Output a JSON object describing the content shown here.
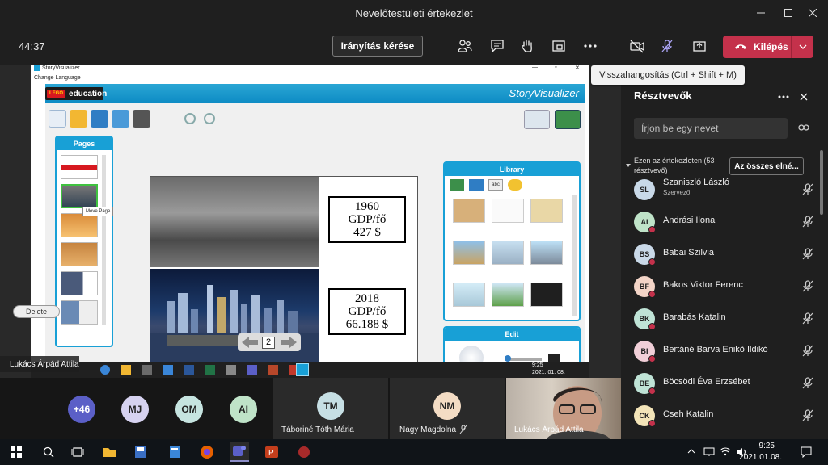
{
  "window": {
    "title": "Nevelőtestületi értekezlet"
  },
  "toolbar": {
    "timer": "44:37",
    "request_control_label": "Irányítás kérése",
    "leave_label": "Kilépés"
  },
  "tooltip": {
    "text": "Visszahangosítás (Ctrl + Shift + M)"
  },
  "shared_screen": {
    "app_title": "StoryVisualizer",
    "menu_item": "Change Language",
    "logo_brand": "LEGO",
    "logo_text": "education",
    "brand": "StoryVisualizer",
    "pages_label": "Pages",
    "move_page_tip": "Move Page",
    "delete_label": "Delete",
    "box_1960": {
      "line1": "1960",
      "line2": "GDP/fő",
      "line3": "427 $"
    },
    "box_2018": {
      "line1": "2018",
      "line2": "GDP/fő",
      "line3": "66.188 $"
    },
    "page_number": "2",
    "library_label": "Library",
    "library_tab_text": "abc",
    "edit_label": "Edit",
    "remote_time": "9:25",
    "remote_date": "2021. 01. 08.",
    "presenter_name": "Lukács Árpád Attila"
  },
  "participants_panel": {
    "title": "Résztvevők",
    "search_placeholder": "Írjon be egy nevet",
    "section_label": "Ezen az értekezleten (53 résztvevő)",
    "admit_all_label": "Az összes elné...",
    "people": [
      {
        "initials": "SL",
        "name": "Szaniszló László",
        "role": "Szervező",
        "color": "#c9d9e8"
      },
      {
        "initials": "AI",
        "name": "Andrási Ilona",
        "role": "",
        "color": "#bfe3c8"
      },
      {
        "initials": "BS",
        "name": "Babai Szilvia",
        "role": "",
        "color": "#c9d9e8"
      },
      {
        "initials": "BF",
        "name": "Bakos Viktor Ferenc",
        "role": "",
        "color": "#f3d4c7"
      },
      {
        "initials": "BK",
        "name": "Barabás Katalin",
        "role": "",
        "color": "#bfe3d6"
      },
      {
        "initials": "BI",
        "name": "Bertáné Barva Enikő Ildikó",
        "role": "",
        "color": "#f1cfd8"
      },
      {
        "initials": "BE",
        "name": "Böcsödi Éva Erzsébet",
        "role": "",
        "color": "#bfe3d6"
      },
      {
        "initials": "CK",
        "name": "Cseh Katalin",
        "role": "",
        "color": "#f3e4b8"
      }
    ]
  },
  "gallery": {
    "overflow_count": "+46",
    "avatars": [
      {
        "initials": "MJ",
        "color": "#d6d2f0"
      },
      {
        "initials": "OM",
        "color": "#c6e4e0"
      },
      {
        "initials": "AI",
        "color": "#bfe3c8"
      }
    ],
    "tiles": [
      {
        "initials": "TM",
        "name": "Táboriné Tóth Mária",
        "color": "#c6dfe4"
      },
      {
        "initials": "NM",
        "name": "Nagy Magdolna",
        "color": "#f3dcc4"
      }
    ],
    "video_name": "Lukács Árpád Attila"
  },
  "taskbar": {
    "time": "9:25",
    "date": "2021.01.08."
  }
}
